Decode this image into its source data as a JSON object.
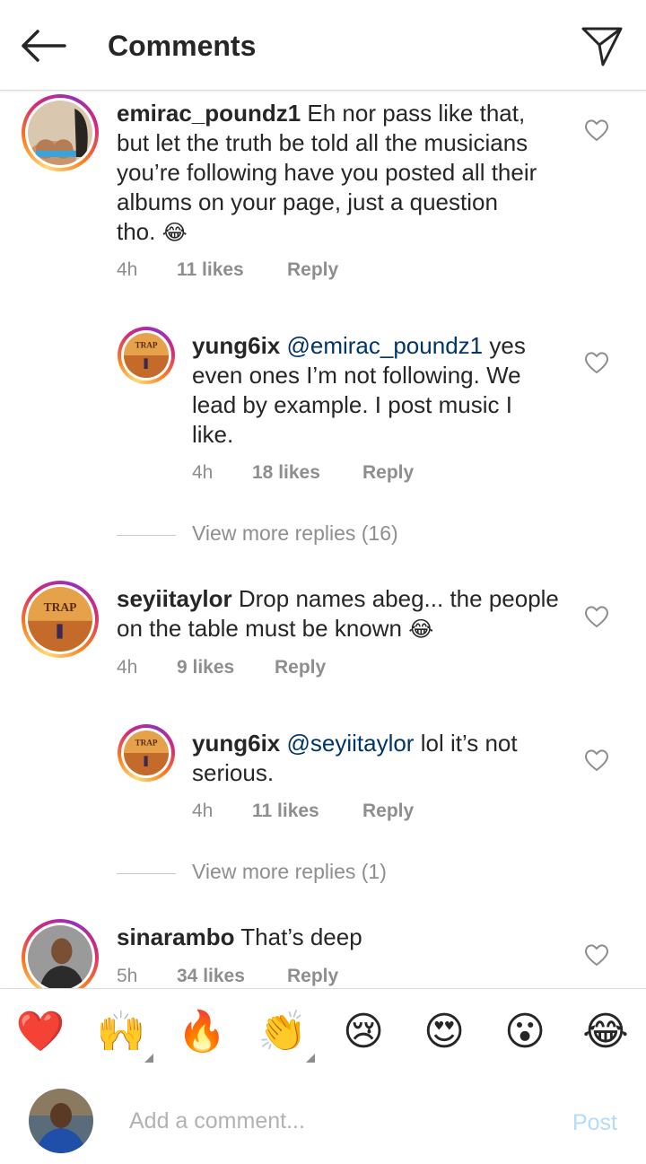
{
  "header": {
    "title": "Comments"
  },
  "comments": [
    {
      "username": "emirac_poundz1",
      "text": "Eh nor pass like that, but let the truth be told all the musicians you’re following have you posted all their albums on your page, just a question tho.",
      "emoji": "😂",
      "time": "4h",
      "likes": "11 likes",
      "reply": "Reply",
      "replies": [
        {
          "username": "yung6ix",
          "mention": "@emirac_poundz1",
          "text": "yes even ones I’m not following. We lead by example. I post music I like.",
          "time": "4h",
          "likes": "18 likes",
          "reply": "Reply"
        }
      ],
      "view_more": "View more replies (16)"
    },
    {
      "username": "seyiitaylor",
      "text": "Drop names abeg... the people on the table must be known",
      "emoji": "😂",
      "time": "4h",
      "likes": "9 likes",
      "reply": "Reply",
      "replies": [
        {
          "username": "yung6ix",
          "mention": "@seyiitaylor",
          "text": "lol it’s not serious.",
          "time": "4h",
          "likes": "11 likes",
          "reply": "Reply"
        }
      ],
      "view_more": "View more replies (1)"
    },
    {
      "username": "sinarambo",
      "text": "That’s deep",
      "time": "5h",
      "likes": "34 likes",
      "reply": "Reply"
    }
  ],
  "emoji_bar": [
    "❤️",
    "🙌",
    "🔥",
    "👏",
    "😢",
    "😍",
    "😮",
    "😂"
  ],
  "composer": {
    "placeholder": "Add a comment...",
    "post_label": "Post"
  },
  "colors": {
    "mention": "#003569",
    "post_disabled": "#b3dbff",
    "meta": "#8e8e8e"
  }
}
